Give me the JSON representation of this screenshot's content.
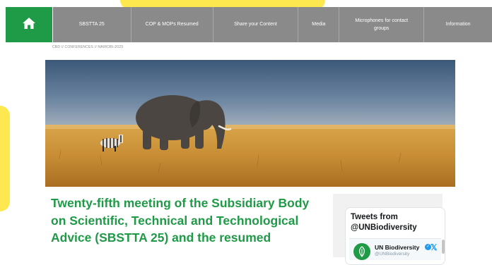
{
  "nav": {
    "items": [
      {
        "label": "SBSTTA 25"
      },
      {
        "label": "COP & MOPs Resumed"
      },
      {
        "label": "Share your Content"
      },
      {
        "label": "Media"
      },
      {
        "label": "Microphones for contact groups"
      },
      {
        "label": "Information"
      }
    ]
  },
  "breadcrumb": "CBD // CONFERENCES // NAIROBI-2023",
  "headline": "Twenty-fifth meeting of the Subsidiary Body on Scientific, Technical and Technological Advice (SBSTTA 25) and the resumed",
  "twitter": {
    "title": "Tweets from @UNBiodiversity",
    "account_name": "UN Biodiversity",
    "handle": "@UNBiodiversity"
  },
  "colors": {
    "brand_green": "#1f9a47",
    "nav_gray": "#8a8a8a",
    "accent_yellow": "#fde84f",
    "twitter_blue": "#1d9bf0"
  },
  "icons": {
    "home": "home-icon",
    "verified": "verified-icon",
    "x": "x-logo-icon"
  }
}
